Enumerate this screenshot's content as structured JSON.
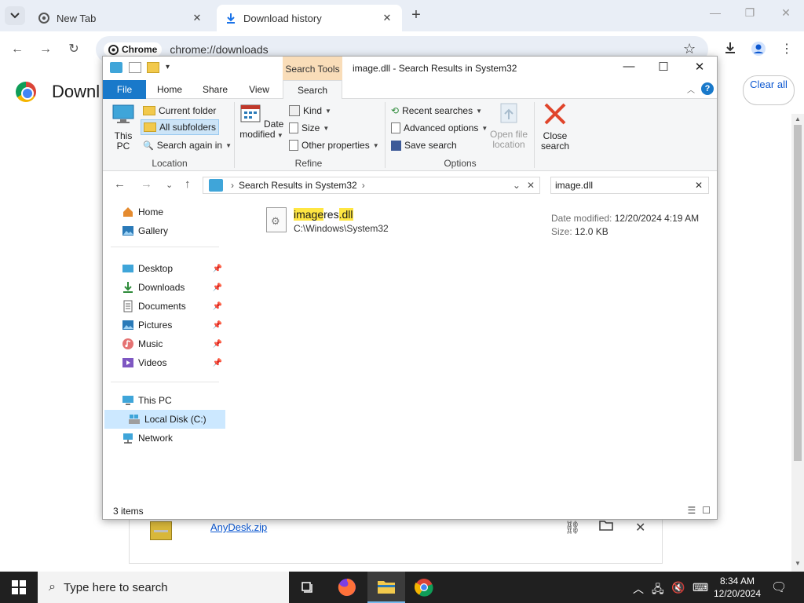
{
  "chrome": {
    "tabs": [
      {
        "title": "New Tab",
        "icon": "chrome-icon"
      },
      {
        "title": "Download history",
        "icon": "download-icon"
      }
    ],
    "omnibox": {
      "chip": "Chrome",
      "url": "chrome://downloads"
    }
  },
  "downloads_page": {
    "title": "Downl",
    "clear_all": "Clear all",
    "item": {
      "filename": "AnyDesk.zip"
    }
  },
  "explorer": {
    "title": "image.dll - Search Results in System32",
    "context_tab": "Search Tools",
    "ribbon_tabs": [
      "File",
      "Home",
      "Share",
      "View",
      "Search"
    ],
    "ribbon": {
      "location": {
        "label": "Location",
        "this_pc": "This PC",
        "current_folder": "Current folder",
        "all_subfolders": "All subfolders",
        "search_again_in": "Search again in"
      },
      "refine": {
        "label": "Refine",
        "date_modified": "Date modified",
        "kind": "Kind",
        "size": "Size",
        "other_properties": "Other properties"
      },
      "options": {
        "label": "Options",
        "recent_searches": "Recent searches",
        "advanced_options": "Advanced options",
        "save_search": "Save search",
        "open_file_location": "Open file location",
        "close_search": "Close search"
      }
    },
    "address": {
      "path": "Search Results in System32"
    },
    "search": {
      "query": "image.dll"
    },
    "nav": {
      "home": "Home",
      "gallery": "Gallery",
      "desktop": "Desktop",
      "downloads": "Downloads",
      "documents": "Documents",
      "pictures": "Pictures",
      "music": "Music",
      "videos": "Videos",
      "this_pc": "This PC",
      "local_disk": "Local Disk (C:)",
      "network": "Network"
    },
    "result": {
      "name_hl1": "image",
      "name_mid": "res",
      "name_hl2": ".dll",
      "path": "C:\\Windows\\System32",
      "date_label": "Date modified:",
      "date_value": "12/20/2024 4:19 AM",
      "size_label": "Size:",
      "size_value": "12.0 KB"
    },
    "status": {
      "count": "3 items"
    }
  },
  "taskbar": {
    "search_placeholder": "Type here to search",
    "time": "8:34 AM",
    "date": "12/20/2024"
  },
  "colors": {
    "accent": "#1979ca",
    "context_tab": "#f9ddb9",
    "highlight": "#ffe642",
    "taskbar": "#202020"
  }
}
